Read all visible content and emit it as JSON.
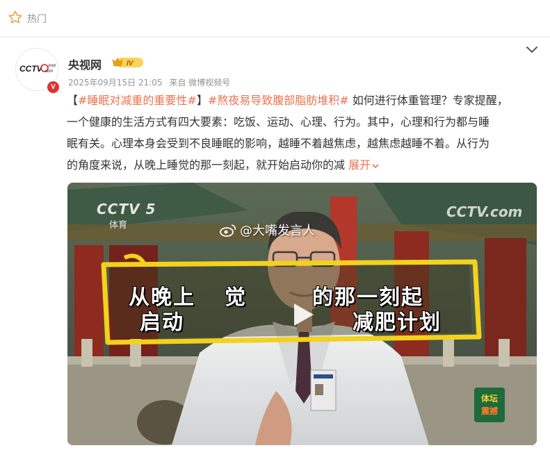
{
  "header": {
    "title": "热门"
  },
  "post": {
    "author": "央视网",
    "avatar_logo_text": "CCTV.com 央视网",
    "verified_badge": "V",
    "level_badge": "IV",
    "meta": {
      "time": "2025年09月15日 21:05",
      "source": "来自 微博视频号"
    },
    "text": {
      "bracket_open": "【",
      "tag1": "#睡眠对减重的重要性#",
      "bracket_close": "】",
      "tag2": "#熬夜易导致腹部脂肪堆积#",
      "line1_rest": " 如何进行体重管理？专家提醒，",
      "line2": "一个健康的生活方式有四大要素：吃饭、运动、心理、行为。其中，心理和行为都与睡",
      "line3": "眠有关。心理本身会受到不良睡眠的影响，越睡不着越焦虑，越焦虑越睡不着。从行为",
      "line4": "的角度来说，从晚上睡觉的那一刻起，就开始启动你的减 ",
      "expand": "展开"
    },
    "video": {
      "channel_logo": "CCTV 5",
      "channel_sub": "体育",
      "site_logo": "CCTV.com",
      "watermark": "@大嘴发言人",
      "caption_line1_a": "从晚上",
      "caption_line1_b": "觉",
      "caption_line1_c": "的那一刻起",
      "caption_line2_a": "启动",
      "caption_line2_b": "减肥计划",
      "corner_logo": "体坛 震撼"
    }
  },
  "colors": {
    "link": "#eb7350",
    "meta": "#939393",
    "caption_frame": "#f3d21c"
  }
}
